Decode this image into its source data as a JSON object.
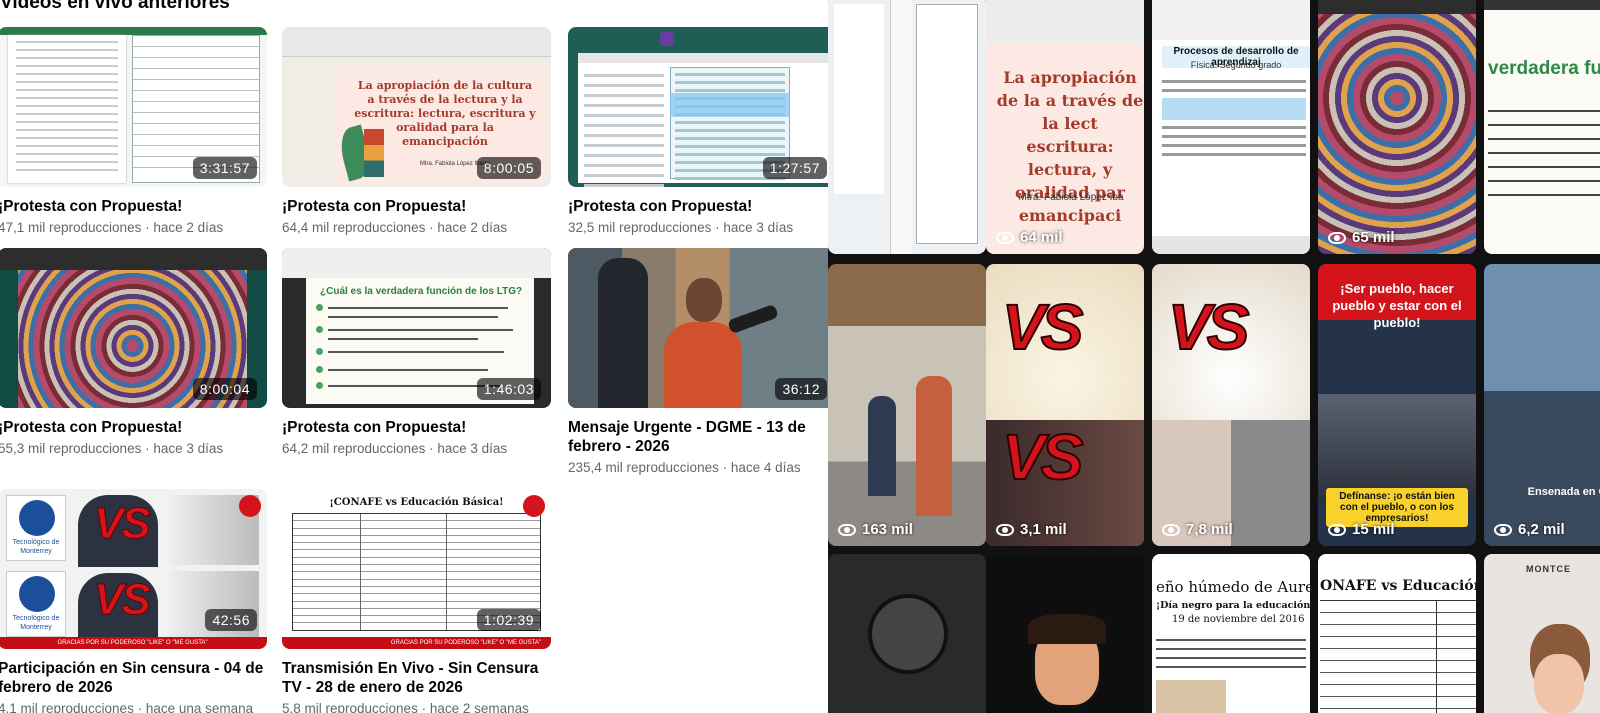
{
  "section_title": "Videos en vivo anteriores",
  "videos": [
    {
      "title": "¡Protesta con Propuesta!",
      "meta": "47,1 mil reproducciones · hace 2 días",
      "duration": "3:31:57"
    },
    {
      "title": "¡Protesta con Propuesta!",
      "meta": "64,4 mil reproducciones · hace 2 días",
      "duration": "8:00:05"
    },
    {
      "title": "¡Protesta con Propuesta!",
      "meta": "32,5 mil reproducciones · hace 3 días",
      "duration": "1:27:57"
    },
    {
      "title": "¡Protesta con Propuesta!",
      "meta": "55,3 mil reproducciones · hace 3 días",
      "duration": "8:00:04"
    },
    {
      "title": "¡Protesta con Propuesta!",
      "meta": "64,2 mil reproducciones · hace 3 días",
      "duration": "1:46:03"
    },
    {
      "title": "Mensaje Urgente - DGME - 13 de",
      "title2": "febrero - 2026",
      "meta": "235,4 mil reproducciones · hace 4 días",
      "duration": "36:12"
    },
    {
      "title": "Participación en Sin censura - 04 de",
      "title2": "febrero de 2026",
      "meta": "4,1 mil reproducciones · hace una semana",
      "duration": "42:56"
    },
    {
      "title": "Transmisión En Vivo - Sin Censura",
      "title2": "TV - 28 de enero de 2026",
      "meta": "5,8 mil reproducciones · hace 2 semanas",
      "duration": "1:02:39"
    }
  ],
  "thumb_text": {
    "slide_title": "La apropiación de la cultura a través de la lectura y la escritura: lectura, escritura y oralidad para la emancipación",
    "slide_author": "Mtra. Fabiola López Ibarra",
    "ltg_question": "¿Cuál es la verdadera función de los LTG?",
    "vs": "VS",
    "tec_logo": "Tecnológico de Monterrey",
    "band": "GRACIAS POR SU PODEROSO \"LIKE\" O \"ME GUSTA\"",
    "conafe_title": "¡CONAFE vs Educación Básica!"
  },
  "reels": [
    {
      "views": "",
      "kind": "doc"
    },
    {
      "views": "64 mil",
      "kind": "slide",
      "text": "La apropiación de la a través de la lect escritura: lectura, y oralidad par emancipaci",
      "author": "Mtra. Fabiola López Iba"
    },
    {
      "views": "",
      "kind": "web",
      "header": "Procesos de desarrollo de aprendizaj",
      "subheader": "Física. Segundo grado"
    },
    {
      "views": "65 mil",
      "kind": "spiral"
    },
    {
      "views": "",
      "kind": "green",
      "text": "verdadera func"
    },
    {
      "views": "163 mil",
      "kind": "hall"
    },
    {
      "views": "3,1 mil",
      "kind": "vs"
    },
    {
      "views": "7,8 mil",
      "kind": "vs2"
    },
    {
      "views": "15 mil",
      "kind": "pueblo",
      "top": "¡Ser pueblo, hacer pueblo y estar con el pueblo!",
      "box": "Defínanse: ¡o están bien con el pueblo, o con los empresarios!"
    },
    {
      "views": "6,2 mil",
      "kind": "ensenada",
      "label": "Ensenada en Cris"
    },
    {
      "views": "",
      "kind": "dark"
    },
    {
      "views": "",
      "kind": "cartoon"
    },
    {
      "views": "",
      "kind": "news",
      "title": "eño húmedo de Aurelio N",
      "sub": "¡Día negro para la educación mexicana!",
      "date": "19 de noviembre del 2016"
    },
    {
      "views": "",
      "kind": "conafe",
      "title": "ONAFE vs Educación Bás"
    },
    {
      "views": "",
      "kind": "montce",
      "label": "MONTCE"
    }
  ]
}
